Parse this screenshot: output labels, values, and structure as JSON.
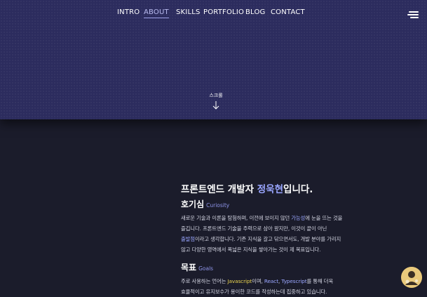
{
  "nav": {
    "items": [
      {
        "label": "INTRO",
        "active": false
      },
      {
        "label": "ABOUT",
        "active": true
      },
      {
        "label": "SKILLS",
        "active": false
      },
      {
        "label": "PORTFOLIO",
        "active": false
      },
      {
        "label": "BLOG",
        "active": false
      },
      {
        "label": "CONTACT",
        "active": false
      }
    ],
    "menu_icon": "hamburger-menu-icon"
  },
  "hero": {
    "scroll_label": "스크롤",
    "scroll_icon": "arrow-down-icon"
  },
  "about": {
    "headline_pre": "프론트엔드 개발자 ",
    "headline_name": "정욱현",
    "headline_post": "입니다.",
    "curiosity": {
      "title": "호기심",
      "subtitle": "Curiosity",
      "line1_a": "새로운 기술과 이론을 탐험하며, 이전에 보이지 않던 ",
      "line1_hl": "가능성",
      "line1_b": "에 눈을 뜨는 것을",
      "line2": "즐깁니다. 프론트엔드 기술을 주력으로 삼아 왔지만, 이것이 끝이 아닌",
      "line3_hl": "출발점",
      "line3_b": "이라고 생각합니다. 기존 지식을 갈고 닦으면서도, 개발 분야를 가리지",
      "line4": "않고 다양한 영역에서 폭넓은 지식을 쌓아가는 것이 제 목표입니다."
    },
    "goals": {
      "title": "목표",
      "subtitle": "Goals",
      "line1_a": "주로 사용하는 언어는 ",
      "line1_js": "Javascript",
      "line1_b": "이며, ",
      "line1_react": "React",
      "line1_c": ", ",
      "line1_ts": "Typescript",
      "line1_d": "를 통해 더욱",
      "line2": "효율적이고 유지보수가 용이한 코드를 작성하는데 집중하고 있습니다."
    }
  },
  "colors": {
    "hero_bg": "#2c2c5e",
    "page_bg": "#1b1c2b",
    "accent": "#9aa6ff",
    "highlight_yellow": "#e8d24f"
  },
  "avatar_icon": "profile-avatar-icon"
}
